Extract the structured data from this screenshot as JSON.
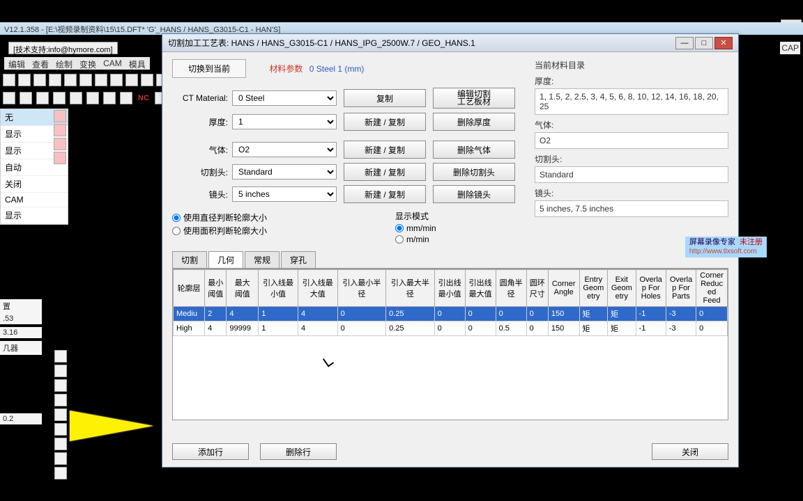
{
  "main": {
    "titlebar": "V12.1.358 - [E:\\视频录制资料\\15\\15.DFT*  'G'_HANS / HANS_G3015-C1        - HAN'S]",
    "support": "[技术支持:info@hymore.com]",
    "menu": [
      "编辑",
      "查看",
      "绘制",
      "变换",
      "CAM",
      "模具"
    ],
    "nc": "NC",
    "cap": "CAP"
  },
  "leftlist": {
    "items": [
      "无",
      "显示",
      "显示",
      "自动",
      "关闭",
      "CAM",
      "显示"
    ],
    "status": [
      "置",
      ".53",
      "3.16",
      "几器"
    ],
    "status2": "0.2"
  },
  "dialog": {
    "title": "切割加工工艺表: HANS / HANS_G3015-C1 / HANS_IPG_2500W.7 / GEO_HANS.1",
    "switch_btn": "切换到当前",
    "mat_params_label": "材料参数",
    "mat_params_val": "0   Steel    1 (mm)",
    "form": {
      "ct_label": "CT Material:",
      "ct_value": "0  Steel",
      "ct_btn1": "复制",
      "ct_btn2": "编辑切割\n工艺板材",
      "th_label": "厚度:",
      "th_value": "1",
      "th_btn1": "新建 / 复制",
      "th_btn2": "删除厚度",
      "gas_label": "气体:",
      "gas_value": "O2",
      "gas_btn1": "新建 / 复制",
      "gas_btn2": "删除气体",
      "head_label": "切割头:",
      "head_value": "Standard",
      "head_btn1": "新建 / 复制",
      "head_btn2": "删除切割头",
      "lens_label": "镜头:",
      "lens_value": "5 inches",
      "lens_btn1": "新建 / 复制",
      "lens_btn2": "删除镜头"
    },
    "right": {
      "cur_mat": "当前材料目录",
      "th_label": "厚度:",
      "th_val": "1, 1.5, 2, 2.5, 3, 4, 5, 6, 8, 10, 12, 14, 16, 18, 20, 25",
      "gas_label": "气体:",
      "gas_val": "O2",
      "head_label": "切割头:",
      "head_val": "Standard",
      "lens_label": "镜头:",
      "lens_val": "5 inches, 7.5 inches"
    },
    "radios": {
      "r1": "使用直径判断轮廓大小",
      "r2": "使用面积判断轮廓大小",
      "mode_label": "显示模式",
      "m1": "mm/min",
      "m2": "m/min"
    },
    "tabs": [
      "切割",
      "几何",
      "常规",
      "穿孔"
    ],
    "grid": {
      "headers": [
        "轮廓层",
        "最小\n阈值",
        "最大\n阈值",
        "引入线最\n小值",
        "引入线最\n大值",
        "引入最小半\n径",
        "引入最大半\n径",
        "引出线\n最小值",
        "引出线\n最大值",
        "圆角半\n径",
        "圆环\n尺寸",
        "Corner\nAngle",
        "Entry\nGeom\netry",
        "Exit\nGeom\netry",
        "Overla\np For\nHoles",
        "Overla\np For\nParts",
        "Corner\nReduc\ned\nFeed"
      ],
      "rows": [
        [
          "Mediu",
          "2",
          "4",
          "1",
          "4",
          "0",
          "0.25",
          "0",
          "0",
          "0",
          "0",
          "150",
          "矩",
          "矩",
          "-1",
          "-3",
          "0"
        ],
        [
          "High",
          "4",
          "99999",
          "1",
          "4",
          "0",
          "0.25",
          "0",
          "0",
          "0.5",
          "0",
          "150",
          "矩",
          "矩",
          "-1",
          "-3",
          "0"
        ]
      ]
    },
    "footer": {
      "add": "添加行",
      "del": "删除行",
      "close": "关闭"
    }
  },
  "watermark": {
    "line1a": "屏幕录像专家",
    "line1b": "未注册",
    "line2": "http://www.tlxsoft.com"
  }
}
